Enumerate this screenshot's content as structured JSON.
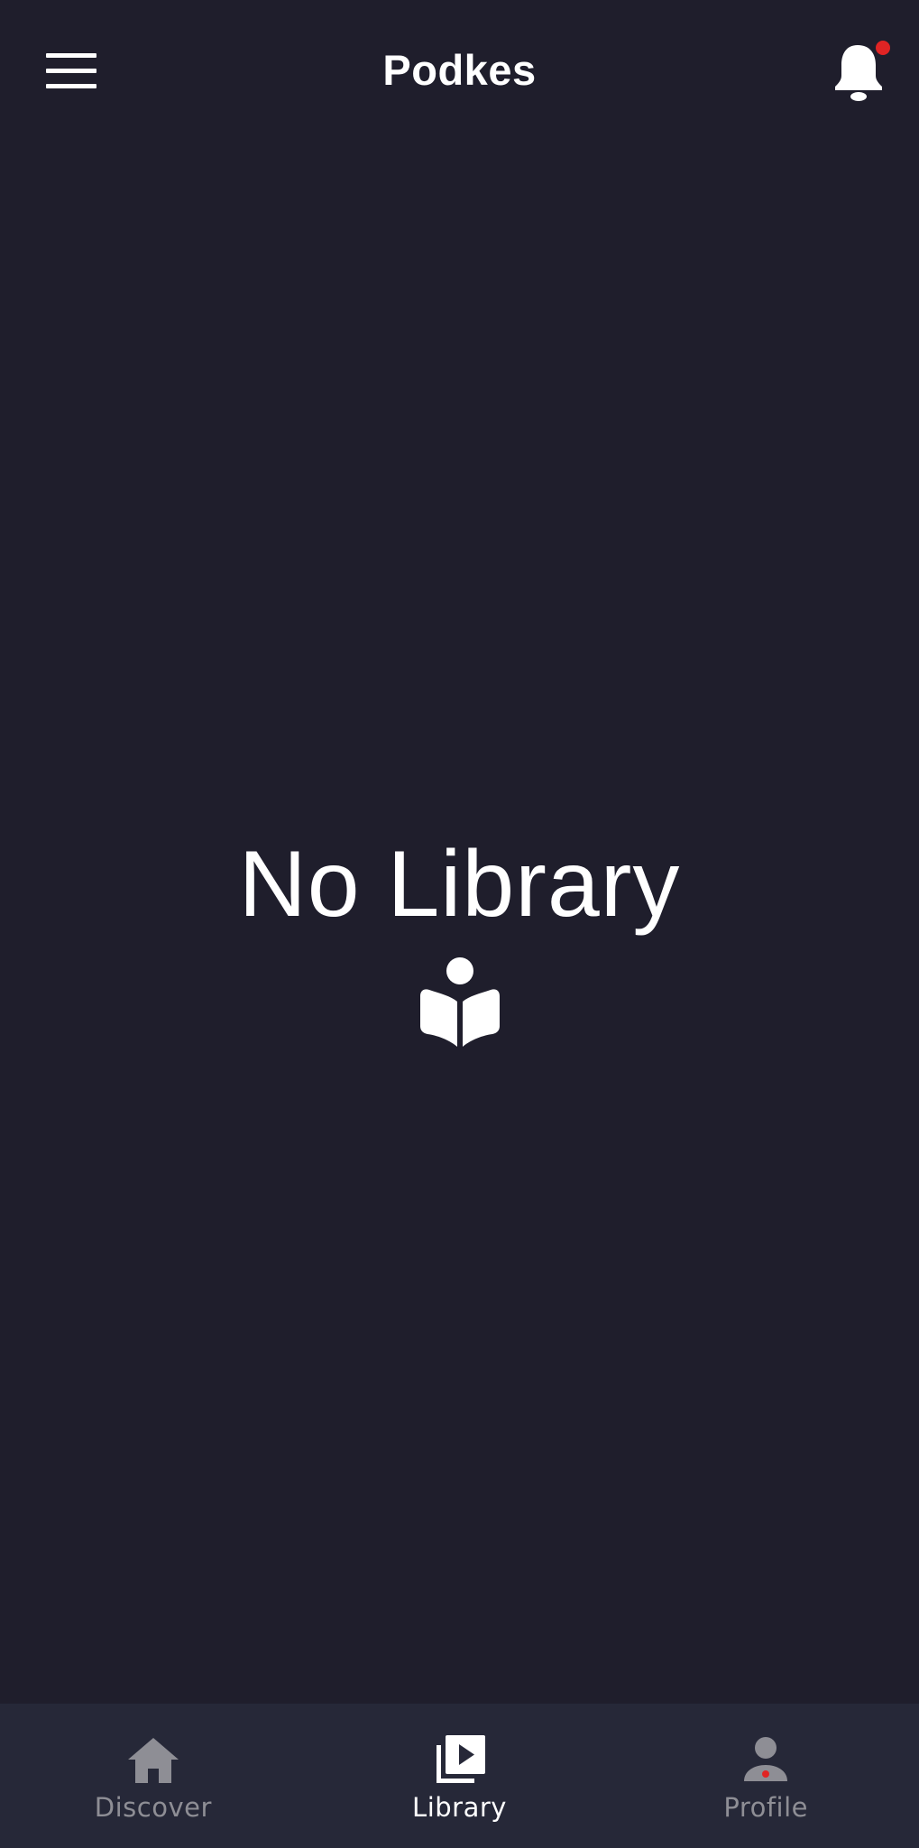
{
  "header": {
    "title": "Podkes",
    "menu_icon": "hamburger-menu-icon",
    "notification_icon": "bell-icon",
    "has_unread_notifications": true
  },
  "empty_state": {
    "title": "No Library",
    "icon": "book-reader-icon"
  },
  "bottom_nav": {
    "items": [
      {
        "label": "Discover",
        "icon": "home-icon",
        "active": false
      },
      {
        "label": "Library",
        "icon": "video-library-icon",
        "active": true
      },
      {
        "label": "Profile",
        "icon": "person-icon",
        "active": false,
        "has_badge": true
      }
    ]
  },
  "colors": {
    "background": "#1f1e2c",
    "nav_background": "#262838",
    "text_primary": "#ffffff",
    "text_inactive": "#8e8e95",
    "badge": "#e02424"
  }
}
